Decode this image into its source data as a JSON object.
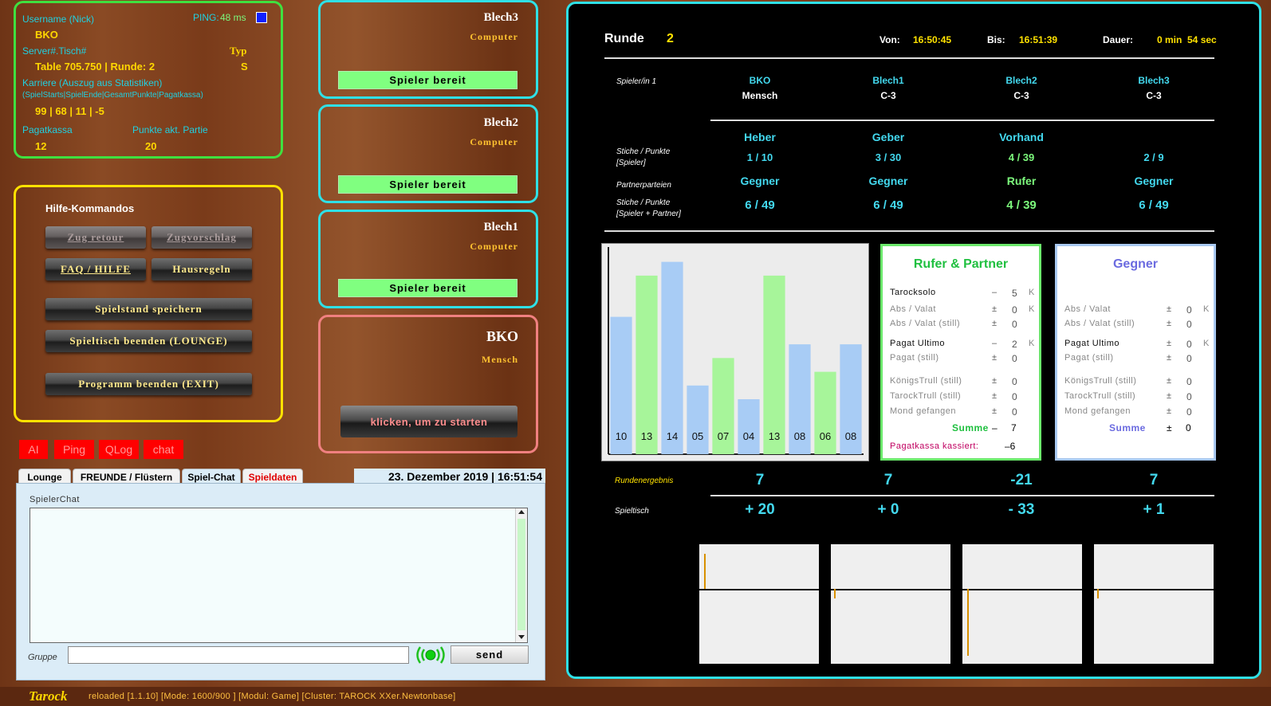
{
  "info": {
    "username_label": "Username (Nick)",
    "ping_label": "PING:",
    "ping_value": "48 ms",
    "username": "BKO",
    "server_label": "Server#.Tisch#",
    "typ_label": "Typ",
    "server_value": "Table 705.750 | Runde: 2",
    "typ_value": "S",
    "career_label": "Karriere (Auszug aus Statistiken)",
    "career_sub": "(SpielStarts|SpielEnde|GesamtPunkte|Pagatkassa)",
    "career_value": "99 | 68 | 11 | -5",
    "pagatkassa_label": "Pagatkassa",
    "punkte_label": "Punkte akt. Partie",
    "pagatkassa_value": "12",
    "punkte_value": "20"
  },
  "help": {
    "title": "Hilfe-Kommandos",
    "zug_retour": "Zug retour",
    "zugvorschlag": "Zugvorschlag",
    "faq": "FAQ / HILFE",
    "hausregeln": "Hausregeln",
    "speichern": "Spielstand speichern",
    "beenden": "Spieltisch beenden (LOUNGE)",
    "exit": "Programm beenden (EXIT)"
  },
  "tags": [
    "AI",
    "Ping",
    "QLog",
    "chat"
  ],
  "chat": {
    "tabs": [
      "Lounge",
      "FREUNDE / Flüstern",
      "Spiel-Chat",
      "Spieldaten"
    ],
    "datetime": "23. Dezember 2019 | 16:51:54",
    "spielerchat_label": "SpielerChat",
    "gruppe_label": "Gruppe",
    "input_value": "",
    "send": "send"
  },
  "players": [
    {
      "name": "Blech3",
      "type": "Computer",
      "button": "Spieler bereit"
    },
    {
      "name": "Blech2",
      "type": "Computer",
      "button": "Spieler bereit"
    },
    {
      "name": "Blech1",
      "type": "Computer",
      "button": "Spieler bereit"
    },
    {
      "name": "BKO",
      "type": "Mensch",
      "button": "klicken, um zu starten"
    }
  ],
  "board": {
    "runde_label": "Runde",
    "runde_value": "2",
    "von_label": "Von:",
    "von_value": "16:50:45",
    "bis_label": "Bis:",
    "bis_value": "16:51:39",
    "dauer_label": "Dauer:",
    "dauer_value": "0 min  54 sec",
    "spieler_label": "Spieler/in 1",
    "stiche_label_1": "Stiche / Punkte",
    "stiche_label_2": "[Spieler]",
    "partner_label": "Partnerparteien",
    "stiche2_label_1": "Stiche / Punkte",
    "stiche2_label_2": "[Spieler + Partner]",
    "rundenergebnis_label": "Rundenergebnis",
    "spieltisch_label": "Spieltisch",
    "columns": [
      {
        "name": "BKO",
        "kind": "Mensch",
        "role": "Heber",
        "sp": "1 / 10",
        "party": "Gegner",
        "spp": "6 / 49",
        "result": "7",
        "table": "+ 20"
      },
      {
        "name": "Blech1",
        "kind": "C-3",
        "role": "Geber",
        "sp": "3 / 30",
        "party": "Gegner",
        "spp": "6 / 49",
        "result": "7",
        "table": "+ 0"
      },
      {
        "name": "Blech2",
        "kind": "C-3",
        "role": "Vorhand",
        "sp": "4 / 39",
        "party": "Rufer",
        "spp": "4 / 39",
        "result": "-21",
        "table": "- 33"
      },
      {
        "name": "Blech3",
        "kind": "C-3",
        "role": "",
        "sp": "2 / 9",
        "party": "Gegner",
        "spp": "6 / 49",
        "result": "7",
        "table": "+ 1"
      }
    ],
    "rufer": {
      "title": "Rufer & Partner",
      "rows": [
        {
          "label": "Tarocksolo",
          "sign": "–",
          "val": "5",
          "k": "K"
        },
        {
          "label": "Abs / Valat",
          "sign": "±",
          "val": "0",
          "k": "K"
        },
        {
          "label": "Abs / Valat (still)",
          "sign": "±",
          "val": "0",
          "k": ""
        },
        {
          "label": "Pagat Ultimo",
          "sign": "–",
          "val": "2",
          "k": "K"
        },
        {
          "label": "Pagat (still)",
          "sign": "±",
          "val": "0",
          "k": ""
        },
        {
          "label": "KönigsTrull (still)",
          "sign": "±",
          "val": "0",
          "k": ""
        },
        {
          "label": "TarockTrull (still)",
          "sign": "±",
          "val": "0",
          "k": ""
        },
        {
          "label": "Mond gefangen",
          "sign": "±",
          "val": "0",
          "k": ""
        }
      ],
      "summe_label": "Summe",
      "summe_sign": "–",
      "summe_val": "7",
      "kassa_label": "Pagatkassa kassiert:",
      "kassa_val": "–6"
    },
    "gegner": {
      "title": "Gegner",
      "rows": [
        {
          "label": "Abs / Valat",
          "sign": "±",
          "val": "0",
          "k": "K"
        },
        {
          "label": "Abs / Valat (still)",
          "sign": "±",
          "val": "0",
          "k": ""
        },
        {
          "label": "Pagat Ultimo",
          "sign": "±",
          "val": "0",
          "k": "K"
        },
        {
          "label": "Pagat (still)",
          "sign": "±",
          "val": "0",
          "k": ""
        },
        {
          "label": "KönigsTrull (still)",
          "sign": "±",
          "val": "0",
          "k": ""
        },
        {
          "label": "TarockTrull (still)",
          "sign": "±",
          "val": "0",
          "k": ""
        },
        {
          "label": "Mond gefangen",
          "sign": "±",
          "val": "0",
          "k": ""
        }
      ],
      "summe_label": "Summe",
      "summe_sign": "±",
      "summe_val": "0"
    }
  },
  "chart_data": {
    "type": "bar",
    "categories": [
      "10",
      "13",
      "14",
      "05",
      "07",
      "04",
      "13",
      "08",
      "06",
      "08"
    ],
    "values": [
      10,
      13,
      14,
      5,
      7,
      4,
      13,
      8,
      6,
      8
    ],
    "colors": [
      "#a8ccf5",
      "#a7f59a",
      "#a8ccf5",
      "#a8ccf5",
      "#a7f59a",
      "#a8ccf5",
      "#a7f59a",
      "#a8ccf5",
      "#a7f59a",
      "#a8ccf5"
    ],
    "ylim": [
      0,
      14.5
    ],
    "title": "",
    "xlabel": "",
    "ylabel": ""
  },
  "status": {
    "logo": "Tarock",
    "text": "reloaded [1.1.10] [Mode: 1600/900 ] [Modul: Game] [Cluster: TAROCK XXer.Newtonbase]"
  },
  "colors": {
    "cyan": "#2fe0e6",
    "green": "#3fe03f",
    "yellow": "#ffe200",
    "ready": "#80ff80"
  }
}
